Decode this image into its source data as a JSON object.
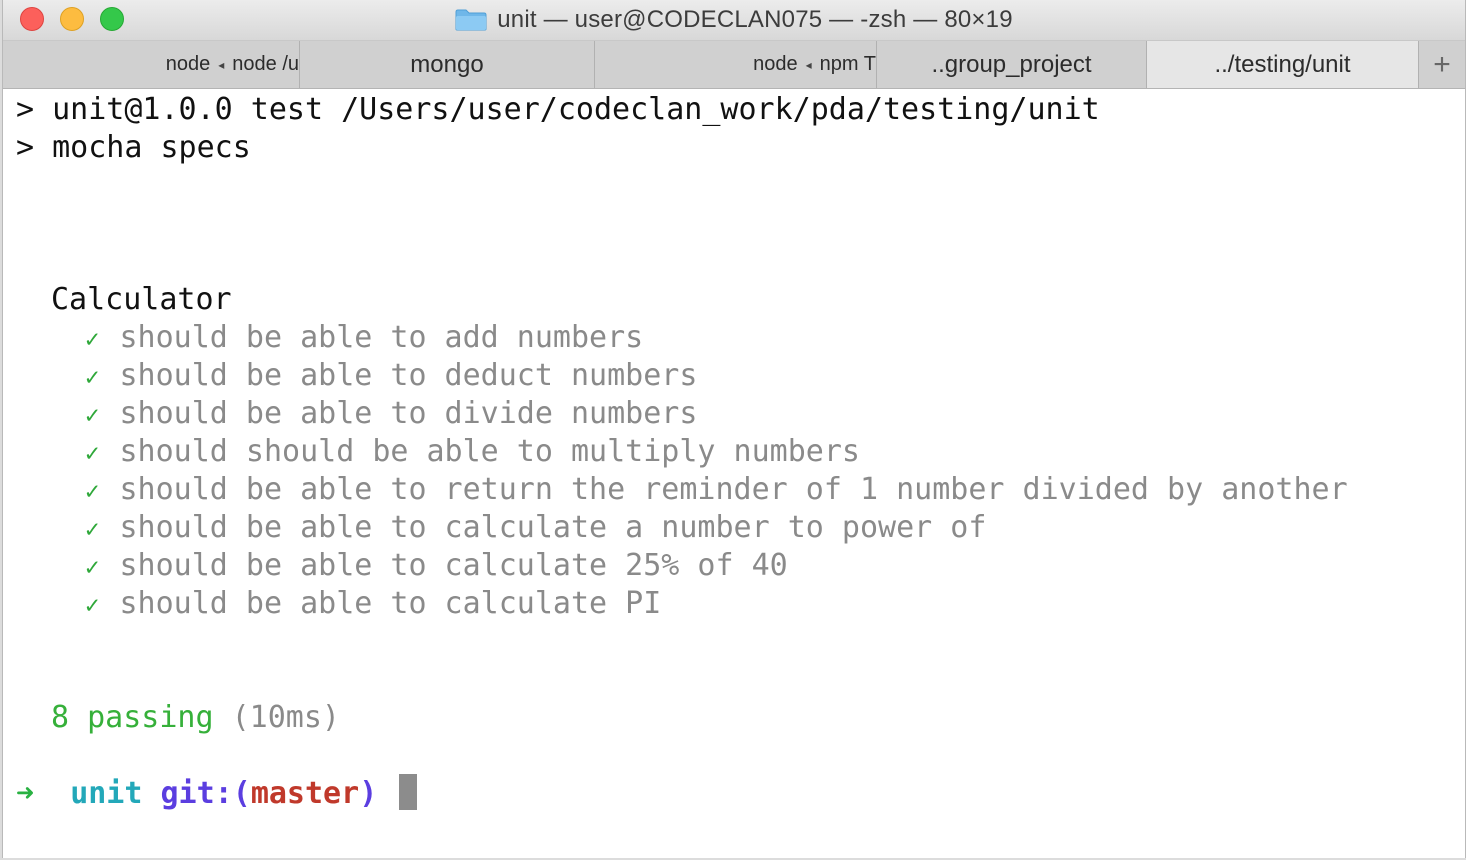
{
  "window": {
    "title": "unit — user@CODECLAN075 — -zsh — 80×19"
  },
  "tabs": [
    {
      "part1": "node",
      "part2": "node /u",
      "active": false
    },
    {
      "label": "mongo",
      "active": false
    },
    {
      "part1": "node",
      "part2": "npm T",
      "active": false
    },
    {
      "label": "..group_project",
      "active": false
    },
    {
      "label": "../testing/unit",
      "active": true
    }
  ],
  "tab_add_label": "+",
  "terminal": {
    "cmd_line_1": "> unit@1.0.0 test /Users/user/codeclan_work/pda/testing/unit",
    "cmd_line_2": "> mocha specs",
    "suite_name": "Calculator",
    "check_glyph": "✓",
    "tests": [
      "should be able to add numbers",
      "should be able to deduct numbers",
      "should be able to divide numbers",
      "should should be able to multiply numbers",
      "should be able to return the reminder of 1 number divided by another",
      "should be able to calculate a number to power of",
      "should be able to calculate 25% of 40",
      "should be able to calculate PI"
    ],
    "summary_pass": "8 passing",
    "summary_duration": "(10ms)",
    "prompt": {
      "arrow": "➜",
      "dir": "unit",
      "git_label": "git:(",
      "branch": "master",
      "git_close": ")"
    }
  },
  "colors": {
    "check": "#2fa83a",
    "passing": "#36b03a",
    "prompt_dir": "#23a8b9",
    "prompt_git": "#5b3ee0",
    "prompt_branch": "#c0392b"
  }
}
